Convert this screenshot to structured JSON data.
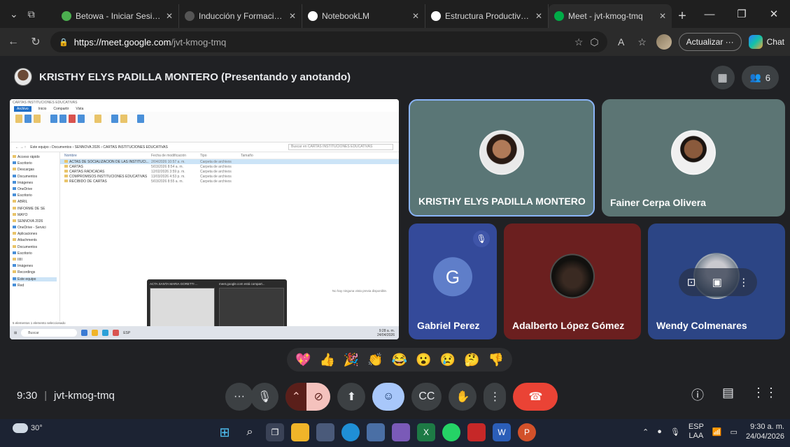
{
  "browser": {
    "tabs": [
      {
        "title": "Betowa - Iniciar Sesión | SE",
        "fav_color": "#4caf50"
      },
      {
        "title": "Inducción y Formación Bio",
        "fav_color": "#555555"
      },
      {
        "title": "NotebookLM",
        "fav_color": "#ffffff"
      },
      {
        "title": "Estructura Productiva y Tra",
        "fav_color": "#ffffff"
      },
      {
        "title": "Meet - jvt-kmog-tmq",
        "fav_color": "#00ac47",
        "active": true
      }
    ],
    "url_host": "https://meet.google.com",
    "url_path": "/jvt-kmog-tmq",
    "update_label": "Actualizar ···",
    "chat_label": "Chat"
  },
  "meet": {
    "presenter_label": "KRISTHY ELYS PADILLA MONTERO (Presentando y anotando)",
    "participant_count": "6",
    "participants": [
      {
        "name": "KRISTHY ELYS PADILLA MONTERO"
      },
      {
        "name": "Fainer Cerpa Olivera"
      },
      {
        "name": "Gabriel Perez",
        "initial": "G",
        "muted": true
      },
      {
        "name": "Adalberto López Gómez"
      },
      {
        "name": "Wendy Colmenares"
      }
    ],
    "reactions": [
      "💖",
      "👍",
      "🎉",
      "👏",
      "😂",
      "😮",
      "😢",
      "🤔",
      "👎"
    ],
    "time": "9:30",
    "meeting_code": "jvt-kmog-tmq"
  },
  "shared_screen": {
    "window_title": "CARTAS INSTITUCIONES EDUCATIVAS",
    "ribbon_tabs": [
      "Archivo",
      "Inicio",
      "Compartir",
      "Vista"
    ],
    "breadcrumb": "Este equipo  ›  Documentos  ›  SENNOVA 2026  ›  CARTAS INSTITUCIONES EDUCATIVAS",
    "search_placeholder": "Buscar en CARTAS INSTITUCIONES EDUCATIVAS",
    "columns": [
      "Nombre",
      "Fecha de modificación",
      "Tipo",
      "Tamaño"
    ],
    "files": [
      {
        "name": "ACTAS DE SOCIALIZACION DE LAS INSTITUCI...",
        "date": "2/04/2026 10:57 a. m.",
        "type": "Carpeta de archivos",
        "selected": true
      },
      {
        "name": "CARTAS",
        "date": "5/03/2026 8:54 a. m.",
        "type": "Carpeta de archivos"
      },
      {
        "name": "CARTAS RADICADAS",
        "date": "12/02/2026 3:59 p. m.",
        "type": "Carpeta de archivos"
      },
      {
        "name": "COMPROMISOS INSTITUCIONES EDUCATIVAS",
        "date": "13/03/2026 4:53 p. m.",
        "type": "Carpeta de archivos"
      },
      {
        "name": "RECIBIDO DE CARTAS",
        "date": "5/03/2026 8:55 a. m.",
        "type": "Carpeta de archivos"
      }
    ],
    "nav_items": [
      "Acceso rápido",
      "Escritorio",
      "Descargas",
      "Documentos",
      "Imágenes",
      "OneDrive",
      "Escritorio",
      "ABRIL",
      "INFORME DE SE",
      "MAYO",
      "SENNOVA 2026",
      "OneDrive - Servici",
      "Aplicaciones",
      "Attachments",
      "Documentos",
      "Escritorio",
      "IIIII",
      "Imágenes",
      "Recordings",
      "Este equipo",
      "Red"
    ],
    "preview_message": "No hay ninguna vista previa disponible.",
    "status": "5 elementos     1 elemento seleccionado",
    "thumbs": [
      "ACTA SANTA MARIA GORETTI ...",
      "meet.google.com está compart..."
    ],
    "taskbar_search": "Buscar",
    "taskbar_time": "9:28 a. m.",
    "taskbar_date": "24/04/2026",
    "taskbar_lang": "ESP"
  },
  "taskbar": {
    "temperature": "30°",
    "lang": "ESP",
    "lang_sub": "LAA",
    "time": "9:30 a. m.",
    "date": "24/04/2026"
  }
}
